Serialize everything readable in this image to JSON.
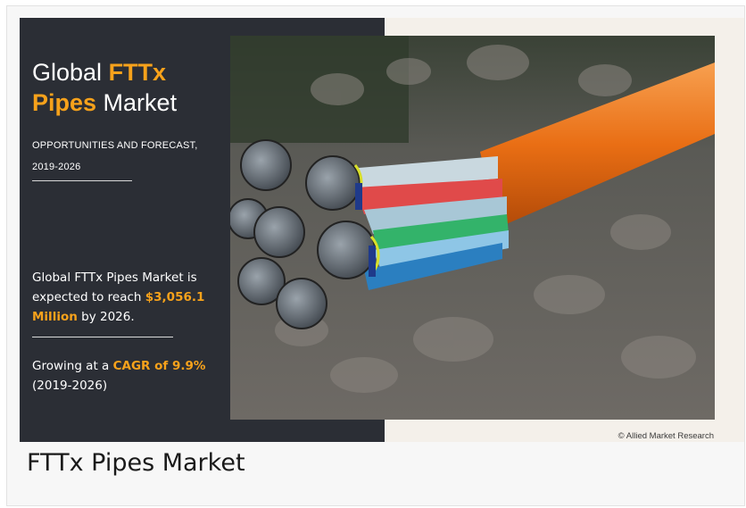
{
  "infographic": {
    "title_prefix": "Global ",
    "title_highlight_1": "FTTx",
    "title_highlight_2": "Pipes",
    "title_suffix": " Market",
    "subtitle_line1": "OPPORTUNITIES AND FORECAST,",
    "subtitle_line2": "2019-2026",
    "fact1_text": "Global FTTx Pipes Market is expected to reach ",
    "fact1_value": "$3,056.1 Million",
    "fact1_suffix": " by 2026.",
    "fact2_prefix": "Growing at a ",
    "fact2_value": "CAGR of 9.9%",
    "fact2_period": "(2019-2026)",
    "copyright": "© Allied Market Research",
    "accent_color": "#f7a21b",
    "panel_color": "#2b2e35"
  },
  "caption": "FTTx Pipes Market"
}
